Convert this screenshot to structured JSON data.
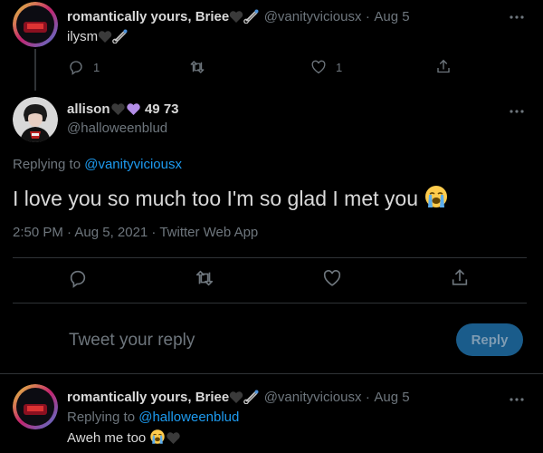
{
  "colors": {
    "background": "#000000",
    "text": "#d9d9d9",
    "muted": "#6e767d",
    "link": "#1d9bf0",
    "reply_button": "#1a5c8b",
    "divider": "#2f3336",
    "heart_purple": "#b48ee8"
  },
  "tweet1": {
    "display_name": "romantically yours, Briee",
    "handle": "@vanityviciousx",
    "sep": "·",
    "date": "Aug 5",
    "text": "ilysm",
    "reply_count": "1",
    "like_count": "1"
  },
  "main": {
    "display_name": "allison",
    "name_suffix": "49 73",
    "handle": "@halloweenblud",
    "replying_prefix": "Replying to",
    "replying_to": "@vanityviciousx",
    "text": "I love you so much too I'm so glad I met you",
    "timestamp": "2:50 PM · Aug 5, 2021 · Twitter Web App"
  },
  "composer": {
    "placeholder": "Tweet your reply",
    "reply_button": "Reply"
  },
  "tweet2": {
    "display_name": "romantically yours, Briee",
    "handle": "@vanityviciousx",
    "sep": "·",
    "date": "Aug 5",
    "replying_prefix": "Replying to",
    "replying_to": "@halloweenblud",
    "text": "Aweh me too"
  },
  "icons": [
    "black-heart-icon",
    "safety-pin-icon",
    "purple-heart-icon",
    "loudly-crying-face-icon",
    "reply-icon",
    "retweet-icon",
    "like-icon",
    "share-icon",
    "more-icon"
  ]
}
